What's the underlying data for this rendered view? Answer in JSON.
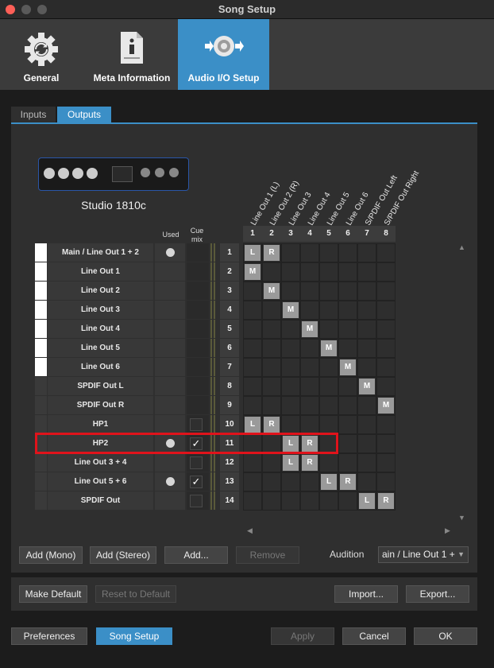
{
  "window": {
    "title": "Song Setup"
  },
  "top_tabs": [
    {
      "label": "General",
      "icon": "gear-icon"
    },
    {
      "label": "Meta Information",
      "icon": "info-document-icon"
    },
    {
      "label": "Audio I/O Setup",
      "icon": "speaker-io-icon",
      "active": true
    }
  ],
  "sub_tabs": [
    {
      "label": "Inputs"
    },
    {
      "label": "Outputs",
      "active": true
    }
  ],
  "device": {
    "name": "Studio 1810c"
  },
  "headers": {
    "used": "Used",
    "cue_mix": "Cue\nmix"
  },
  "columns": [
    {
      "num": "1",
      "label": "Line Out 1 (L)"
    },
    {
      "num": "2",
      "label": "Line Out 2 (R)"
    },
    {
      "num": "3",
      "label": "Line Out 3"
    },
    {
      "num": "4",
      "label": "Line Out 4"
    },
    {
      "num": "5",
      "label": "Line Out 5"
    },
    {
      "num": "6",
      "label": "Line Out 6"
    },
    {
      "num": "7",
      "label": "S/PDIF Out Left"
    },
    {
      "num": "8",
      "label": "S/PDIF Out Right"
    }
  ],
  "rows": [
    {
      "name": "Main / Line Out 1 + 2",
      "used": true,
      "cue": null,
      "num": "1",
      "white": true,
      "marks": [
        [
          1,
          "L"
        ],
        [
          2,
          "R"
        ]
      ]
    },
    {
      "name": "Line Out 1",
      "used": false,
      "cue": null,
      "num": "2",
      "white": true,
      "marks": [
        [
          1,
          "M"
        ]
      ]
    },
    {
      "name": "Line Out 2",
      "used": false,
      "cue": null,
      "num": "3",
      "white": true,
      "marks": [
        [
          2,
          "M"
        ]
      ]
    },
    {
      "name": "Line Out 3",
      "used": false,
      "cue": null,
      "num": "4",
      "white": true,
      "marks": [
        [
          3,
          "M"
        ]
      ]
    },
    {
      "name": "Line Out 4",
      "used": false,
      "cue": null,
      "num": "5",
      "white": true,
      "marks": [
        [
          4,
          "M"
        ]
      ]
    },
    {
      "name": "Line Out 5",
      "used": false,
      "cue": null,
      "num": "6",
      "white": true,
      "marks": [
        [
          5,
          "M"
        ]
      ]
    },
    {
      "name": "Line Out 6",
      "used": false,
      "cue": null,
      "num": "7",
      "white": true,
      "marks": [
        [
          6,
          "M"
        ]
      ]
    },
    {
      "name": "SPDIF Out L",
      "used": false,
      "cue": null,
      "num": "8",
      "white": false,
      "marks": [
        [
          7,
          "M"
        ]
      ]
    },
    {
      "name": "SPDIF Out R",
      "used": false,
      "cue": null,
      "num": "9",
      "white": false,
      "marks": [
        [
          8,
          "M"
        ]
      ]
    },
    {
      "name": "HP1",
      "used": false,
      "cue": false,
      "num": "10",
      "white": false,
      "marks": [
        [
          1,
          "L"
        ],
        [
          2,
          "R"
        ]
      ]
    },
    {
      "name": "HP2",
      "used": true,
      "cue": true,
      "num": "11",
      "white": false,
      "marks": [
        [
          3,
          "L"
        ],
        [
          4,
          "R"
        ]
      ]
    },
    {
      "name": "Line Out 3 + 4",
      "used": false,
      "cue": false,
      "num": "12",
      "white": false,
      "marks": [
        [
          3,
          "L"
        ],
        [
          4,
          "R"
        ]
      ]
    },
    {
      "name": "Line Out 5 + 6",
      "used": true,
      "cue": true,
      "num": "13",
      "white": false,
      "marks": [
        [
          5,
          "L"
        ],
        [
          6,
          "R"
        ]
      ]
    },
    {
      "name": "SPDIF Out",
      "used": false,
      "cue": false,
      "num": "14",
      "white": false,
      "marks": [
        [
          7,
          "L"
        ],
        [
          8,
          "R"
        ]
      ]
    }
  ],
  "buttons": {
    "add_mono": "Add (Mono)",
    "add_stereo": "Add (Stereo)",
    "add": "Add...",
    "remove": "Remove",
    "make_default": "Make Default",
    "reset_default": "Reset to Default",
    "import": "Import...",
    "export": "Export...",
    "preferences": "Preferences",
    "song_setup": "Song Setup",
    "apply": "Apply",
    "cancel": "Cancel",
    "ok": "OK"
  },
  "audition": {
    "label": "Audition",
    "value": "ain / Line Out 1 +"
  },
  "colors": {
    "accent": "#3b8fc7",
    "highlight": "#e0131b"
  }
}
